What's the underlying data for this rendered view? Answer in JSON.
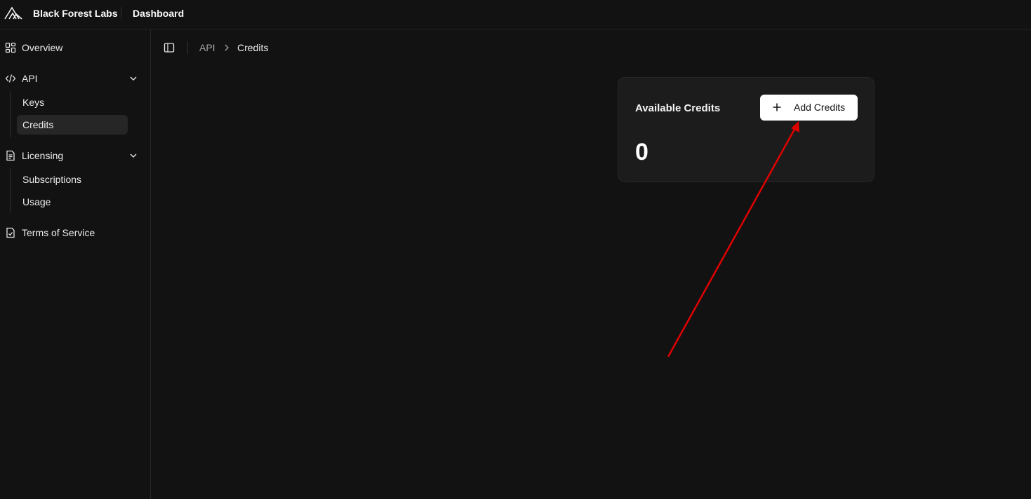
{
  "header": {
    "brand": "Black Forest Labs",
    "section": "Dashboard",
    "logo_icon": "bfl-logo-icon"
  },
  "sidebar": {
    "overview": {
      "label": "Overview",
      "icon": "grid-icon"
    },
    "api": {
      "label": "API",
      "icon": "code-icon",
      "expanded": true,
      "items": [
        {
          "label": "Keys"
        },
        {
          "label": "Credits",
          "active": true
        }
      ]
    },
    "licensing": {
      "label": "Licensing",
      "icon": "document-icon",
      "expanded": true,
      "items": [
        {
          "label": "Subscriptions"
        },
        {
          "label": "Usage"
        }
      ]
    },
    "terms": {
      "label": "Terms of Service",
      "icon": "file-check-icon"
    }
  },
  "breadcrumb": {
    "items": [
      "API",
      "Credits"
    ],
    "separator_icon": "chevron-right-icon"
  },
  "credits_card": {
    "title": "Available Credits",
    "button_label": "Add Credits",
    "button_icon": "plus-icon",
    "value": "0"
  },
  "annotation": {
    "type": "arrow",
    "color": "#e00000",
    "points_to": "add-credits-button"
  },
  "colors": {
    "background": "#121212",
    "card": "#1c1c1c",
    "border": "#262626",
    "active_item": "#262626",
    "button_bg": "#ffffff"
  }
}
